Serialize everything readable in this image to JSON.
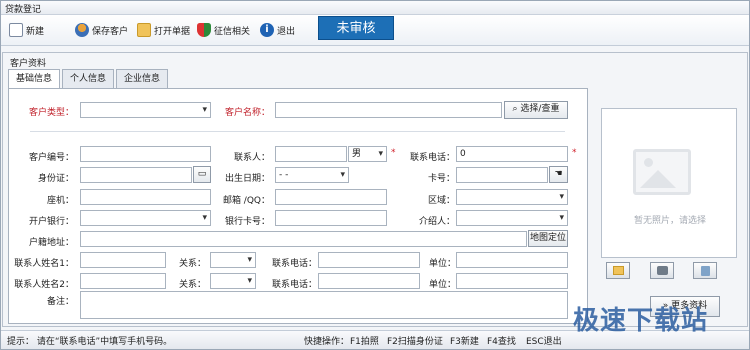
{
  "window": {
    "title": "贷款登记"
  },
  "toolbar": {
    "new": "新建",
    "save_customer": "保存客户",
    "open_list": "打开单据",
    "credit": "征信相关",
    "exit": "退出",
    "status": "未审核"
  },
  "section_title": "客户资料",
  "tabs": [
    "基础信息",
    "个人信息",
    "企业信息"
  ],
  "form": {
    "customer_type_label": "客户类型：",
    "customer_name_label": "客户名称：",
    "select_button": "选择/查重",
    "customer_no_label": "客户编号：",
    "contact_label": "联系人：",
    "gender_value": "男",
    "phone_label": "联系电话：",
    "phone_value": "0",
    "id_label": "身份证：",
    "birth_label": "出生日期：",
    "birth_value": "-   -",
    "card_label": "卡号：",
    "landline_label": "座机：",
    "email_label": "邮箱 /QQ：",
    "area_label": "区域：",
    "bank_label": "开户银行：",
    "bank_card_label": "银行卡号：",
    "referrer_label": "介绍人：",
    "address_label": "户籍地址：",
    "map_button": "地图定位",
    "contact1_name_label": "联系人姓名1：",
    "contact2_name_label": "联系人姓名2：",
    "relation_label": "关系：",
    "contact_phone_label": "联系电话：",
    "unit_label": "单位：",
    "remark_label": "备注："
  },
  "photo": {
    "placeholder": "暂无照片，请选择"
  },
  "more_button": "更多资料",
  "statusbar": {
    "hint": "提示： 请在“联系电话”中填写手机号码。",
    "shortcuts_label": "快捷操作：",
    "f1": "F1拍照",
    "f2": "F2扫描身份证",
    "f3": "F3新建",
    "f4": "F4查找",
    "esc": "ESC退出"
  },
  "watermark": "极速下载站",
  "colors": {
    "status_blue": "#1d6fb6",
    "required_red": "#c0202a"
  }
}
